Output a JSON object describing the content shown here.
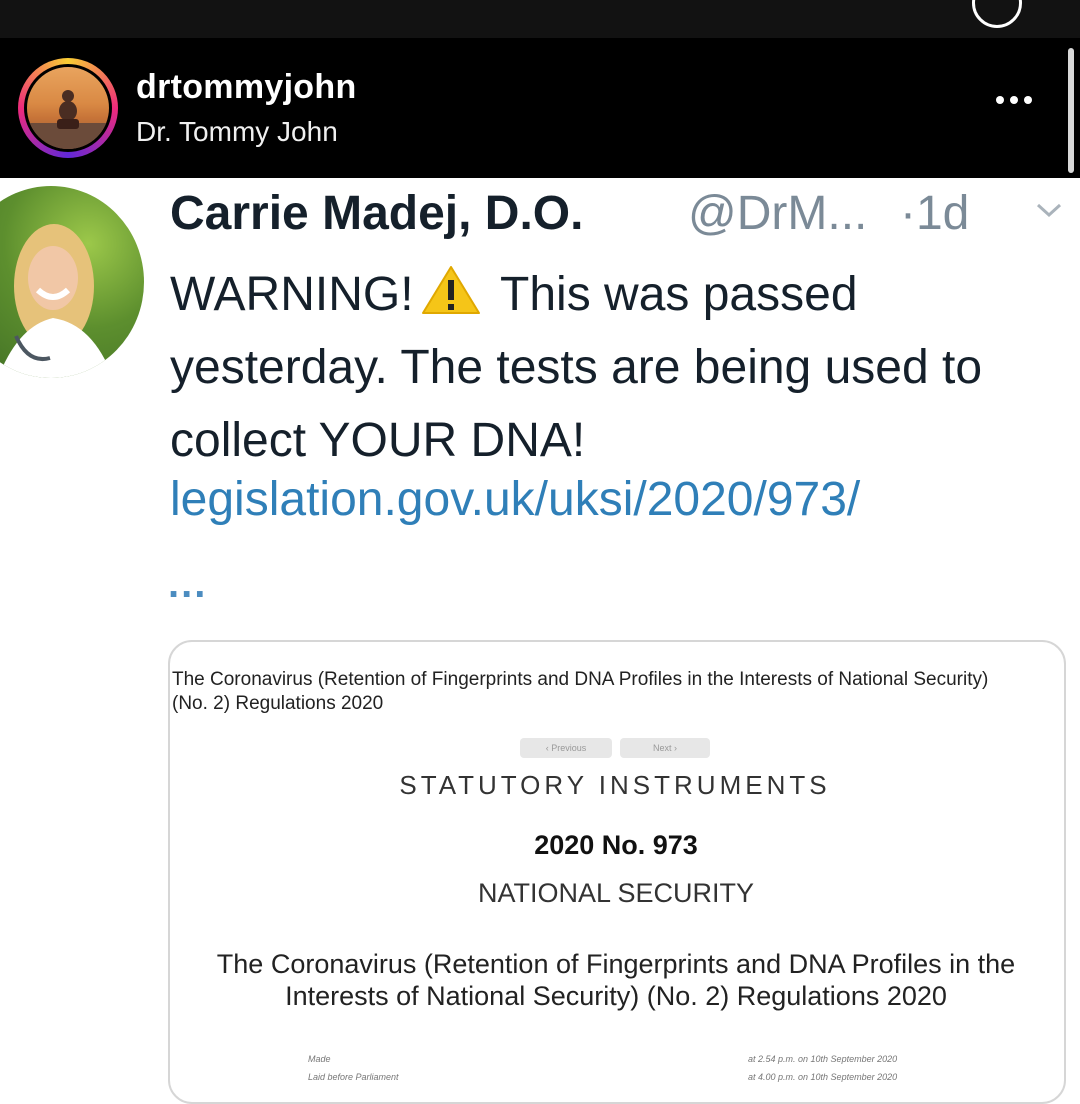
{
  "post_header": {
    "username": "drtommyjohn",
    "full_name": "Dr. Tommy John"
  },
  "tweet": {
    "author_name": "Carrie Madej, D.O.",
    "handle": "@DrM...",
    "time": "·1d",
    "text_before_icon": "WARNING!",
    "text_after_icon": " This was passed yesterday.  The tests are being used to collect YOUR DNA!",
    "link": "legislation.gov.uk/uksi/2020/973/",
    "ellipsis": "..."
  },
  "document": {
    "header": "The Coronavirus (Retention of Fingerprints and DNA Profiles in the Interests of National Security) (No. 2) Regulations 2020",
    "previous_label": "‹ Previous",
    "next_label": "Next ›",
    "series": "STATUTORY INSTRUMENTS",
    "number": "2020 No. 973",
    "subject": "NATIONAL SECURITY",
    "full_title": "The Coronavirus (Retention of Fingerprints and DNA Profiles in the Interests of National Security) (No. 2) Regulations 2020",
    "made_label": "Made",
    "laid_label": "Laid before Parliament",
    "made_time": "at 2.54 p.m. on 10th September 2020",
    "laid_time": "at 4.00 p.m. on 10th September 2020"
  },
  "colors": {
    "header_bg": "#000000",
    "link": "#2f7fb8",
    "handle": "#7b8a97",
    "warning": "#f5c518"
  },
  "icons": {
    "more": "more-horizontal-icon",
    "warning": "warning-icon",
    "chevron": "chevron-down-icon"
  }
}
